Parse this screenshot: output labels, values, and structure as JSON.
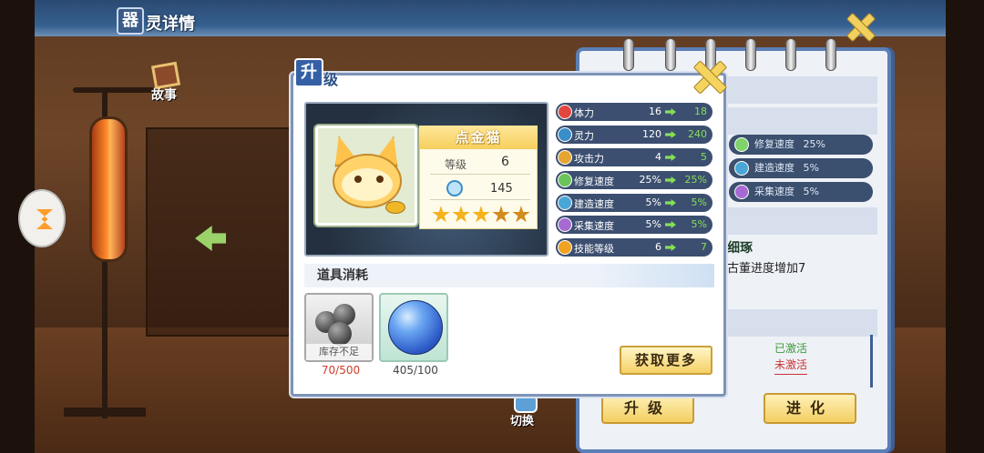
{
  "header": {
    "icon_char": "器",
    "title": "灵详情"
  },
  "side": {
    "story_label": "故事",
    "switch_label": "切换"
  },
  "notebook": {
    "stats": [
      {
        "name": "修复速度",
        "value": "25%"
      },
      {
        "name": "建造速度",
        "value": "5%"
      },
      {
        "name": "采集速度",
        "value": "5%"
      }
    ],
    "skill_title": "细琢",
    "skill_desc": "古董进度增加7",
    "status_active": "已激活",
    "status_inactive": "未激活",
    "upgrade_button": "升级",
    "evolve_button": "进化"
  },
  "dialog": {
    "badge": "升",
    "title": "级",
    "character": {
      "name": "点金猫",
      "level_label": "等级",
      "level": "6",
      "spirit": "145",
      "stars_total": 5,
      "stars_bright": 3
    },
    "stats": [
      {
        "name": "体力",
        "from": "16",
        "to": "18",
        "icon_color": "#e2473f"
      },
      {
        "name": "灵力",
        "from": "120",
        "to": "240",
        "icon_color": "#3a8ec8"
      },
      {
        "name": "攻击力",
        "from": "4",
        "to": "5",
        "icon_color": "#e6a531"
      },
      {
        "name": "修复速度",
        "from": "25%",
        "to": "25%",
        "icon_color": "#6cc35a"
      },
      {
        "name": "建造速度",
        "from": "5%",
        "to": "5%",
        "icon_color": "#4aa6d6"
      },
      {
        "name": "采集速度",
        "from": "5%",
        "to": "5%",
        "icon_color": "#a76ad2"
      },
      {
        "name": "技能等级",
        "from": "6",
        "to": "7",
        "icon_color": "#f0a321"
      }
    ],
    "consume_title": "道具消耗",
    "items": [
      {
        "name": "gray-stone",
        "stock_label": "库存不足",
        "count": "70/500"
      },
      {
        "name": "blue-orb",
        "count": "405/100"
      }
    ],
    "get_more_button": "获取更多"
  },
  "colors": {
    "accent_blue": "#3560a6",
    "stat_bar": "#3c4f70",
    "stat_up_green": "#86df57",
    "insufficient_red": "#d03c2a",
    "button_gold": "#f5d067"
  }
}
